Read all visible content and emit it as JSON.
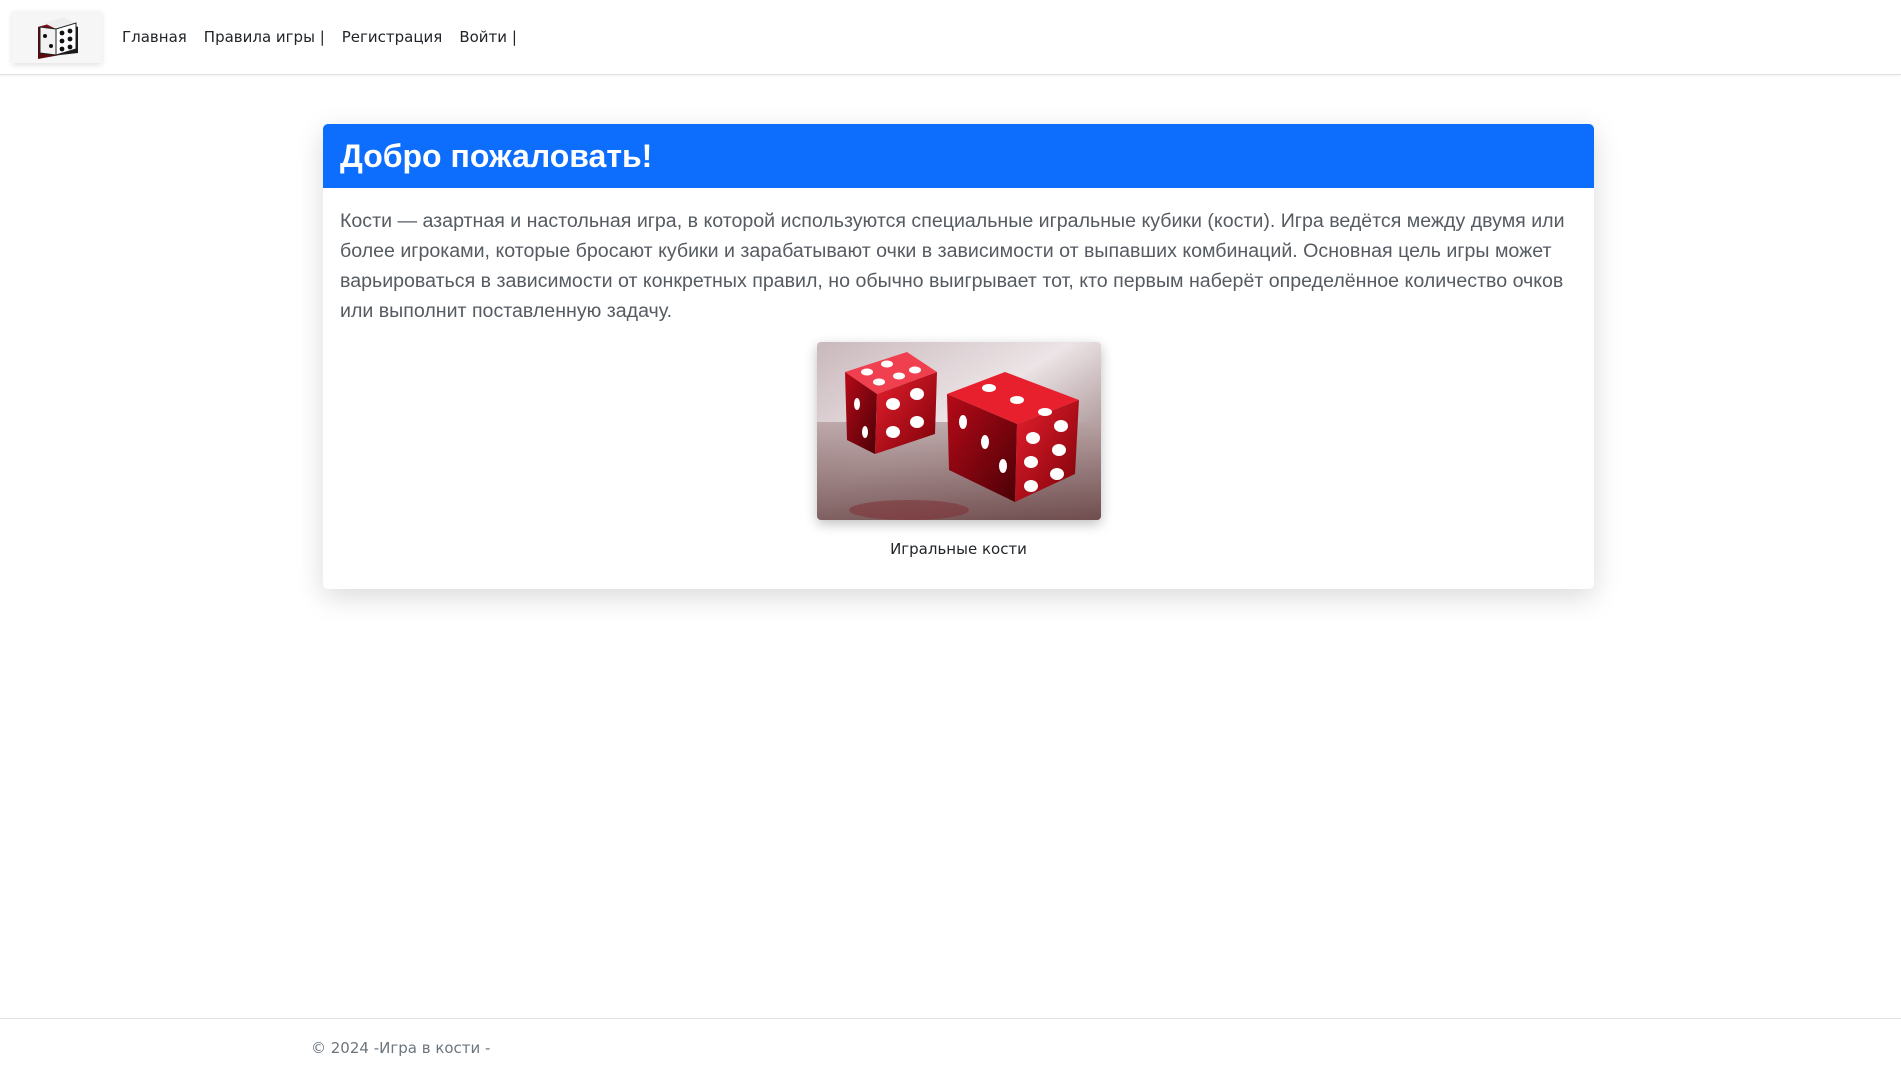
{
  "nav": {
    "brand_icon": "dice-icon",
    "links": [
      "Главная",
      "Правила игры |",
      "Регистрация",
      "Войти |"
    ]
  },
  "welcome": {
    "title": "Добро пожаловать!",
    "text": "Кости — азартная и настольная игра, в которой используются специальные игральные кубики (кости). Игра ведётся между двумя или более игроками, которые бросают кубики и зарабатывают очки в зависимости от выпавших комбинаций. Основная цель игры может варьироваться в зависимости от конкретных правил, но обычно выигрывает тот, кто первым наберёт определённое количество очков или выполнит поставленную задачу.",
    "image_caption": "Игральные кости"
  },
  "footer": {
    "text": "© 2024 -Игра в кости -"
  },
  "colors": {
    "header_bg": "#0d6efd",
    "dice_red": "#c8102e"
  }
}
